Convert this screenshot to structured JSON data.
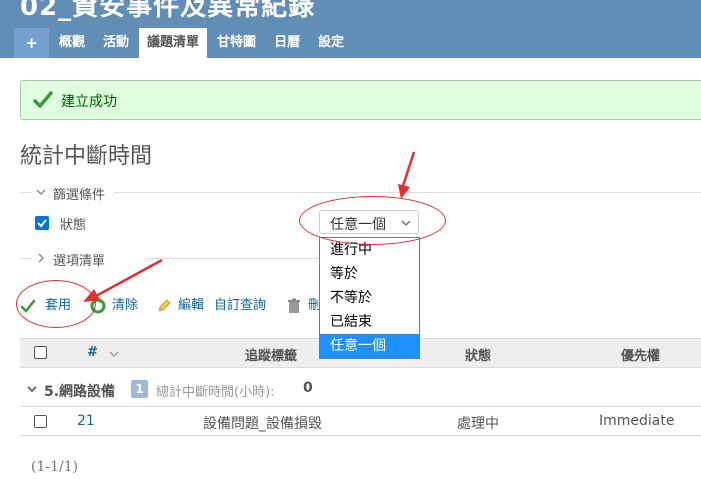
{
  "header": {
    "project_title": "02_資安事件及異常紀錄",
    "tabs": [
      {
        "label": "+"
      },
      {
        "label": "概觀"
      },
      {
        "label": "活動"
      },
      {
        "label": "議題清單",
        "selected": true
      },
      {
        "label": "甘特圖"
      },
      {
        "label": "日曆"
      },
      {
        "label": "設定"
      }
    ]
  },
  "flash": {
    "message": "建立成功"
  },
  "page_title": "統計中斷時間",
  "filters": {
    "legend": "篩選條件",
    "status_label": "狀態",
    "status_checked": true,
    "operator_selected": "任意一個",
    "operator_options": [
      "進行中",
      "等於",
      "不等於",
      "已結束",
      "任意一個"
    ]
  },
  "options_legend": "選項清單",
  "toolbar": {
    "apply": "套用",
    "clear": "清除",
    "edit": "編輯",
    "custom_query": "自訂查詢",
    "delete_partial": "刪"
  },
  "table": {
    "columns": [
      "#",
      "追蹤標籤",
      "狀態",
      "優先權"
    ],
    "group": {
      "name": "5.網路設備",
      "count": "1",
      "total_label": "總計中斷時間(小時):",
      "total_value": "0"
    },
    "rows": [
      {
        "id": "21",
        "tracker": "設備問題_設備損毀",
        "status": "處理中",
        "priority": "Immediate"
      }
    ]
  },
  "pagination": "(1-1/1)",
  "colors": {
    "header": "#628db6",
    "tab": "#759fcf",
    "link": "#116699",
    "flash_bg": "#dfffdf",
    "selected_option": "#1e90ff",
    "annotation": "#e03030"
  }
}
